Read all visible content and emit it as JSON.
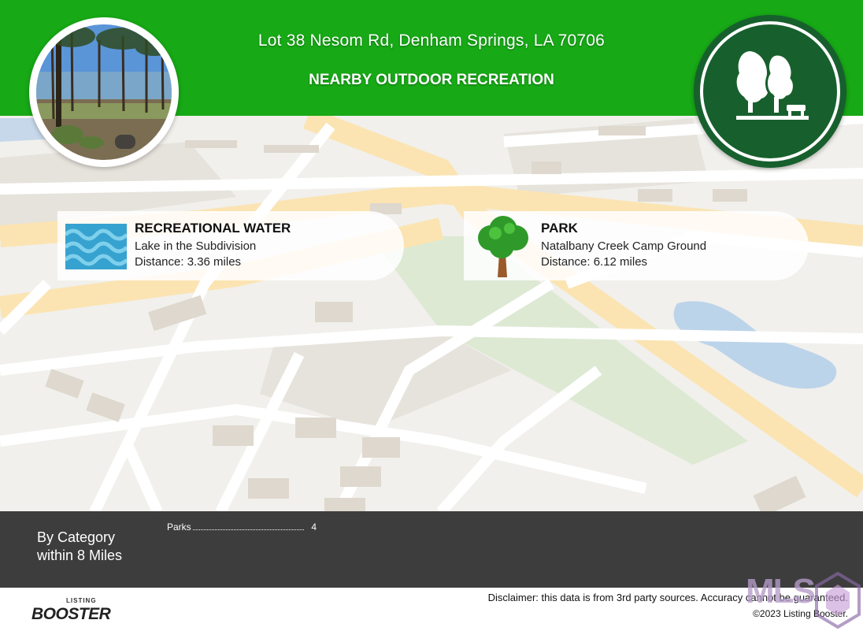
{
  "header": {
    "address": "Lot 38 Nesom Rd, Denham Springs, LA 70706",
    "subtitle": "NEARBY OUTDOOR RECREATION",
    "color": "#17a916",
    "badge_icon": "park-trees-icon"
  },
  "cards": [
    {
      "title": "RECREATIONAL WATER",
      "name": "Lake in the Subdivision",
      "distance": "Distance: 3.36 miles",
      "icon": "water-waves-icon"
    },
    {
      "title": "PARK",
      "name": "Natalbany Creek Camp Ground",
      "distance": "Distance: 6.12 miles",
      "icon": "tree-icon"
    }
  ],
  "footer": {
    "by_category_line1": "By Category",
    "by_category_line2": "within 8 Miles",
    "categories": [
      {
        "label": "Parks",
        "count": "4"
      }
    ]
  },
  "branding": {
    "logo_small": "LISTING",
    "logo_big": "BOOSTER",
    "disclaimer": "Disclaimer: this data is from 3rd party sources. Accuracy cannot be guaranteed.",
    "copyright": "©2023 Listing Booster.",
    "watermark": "MLS"
  }
}
